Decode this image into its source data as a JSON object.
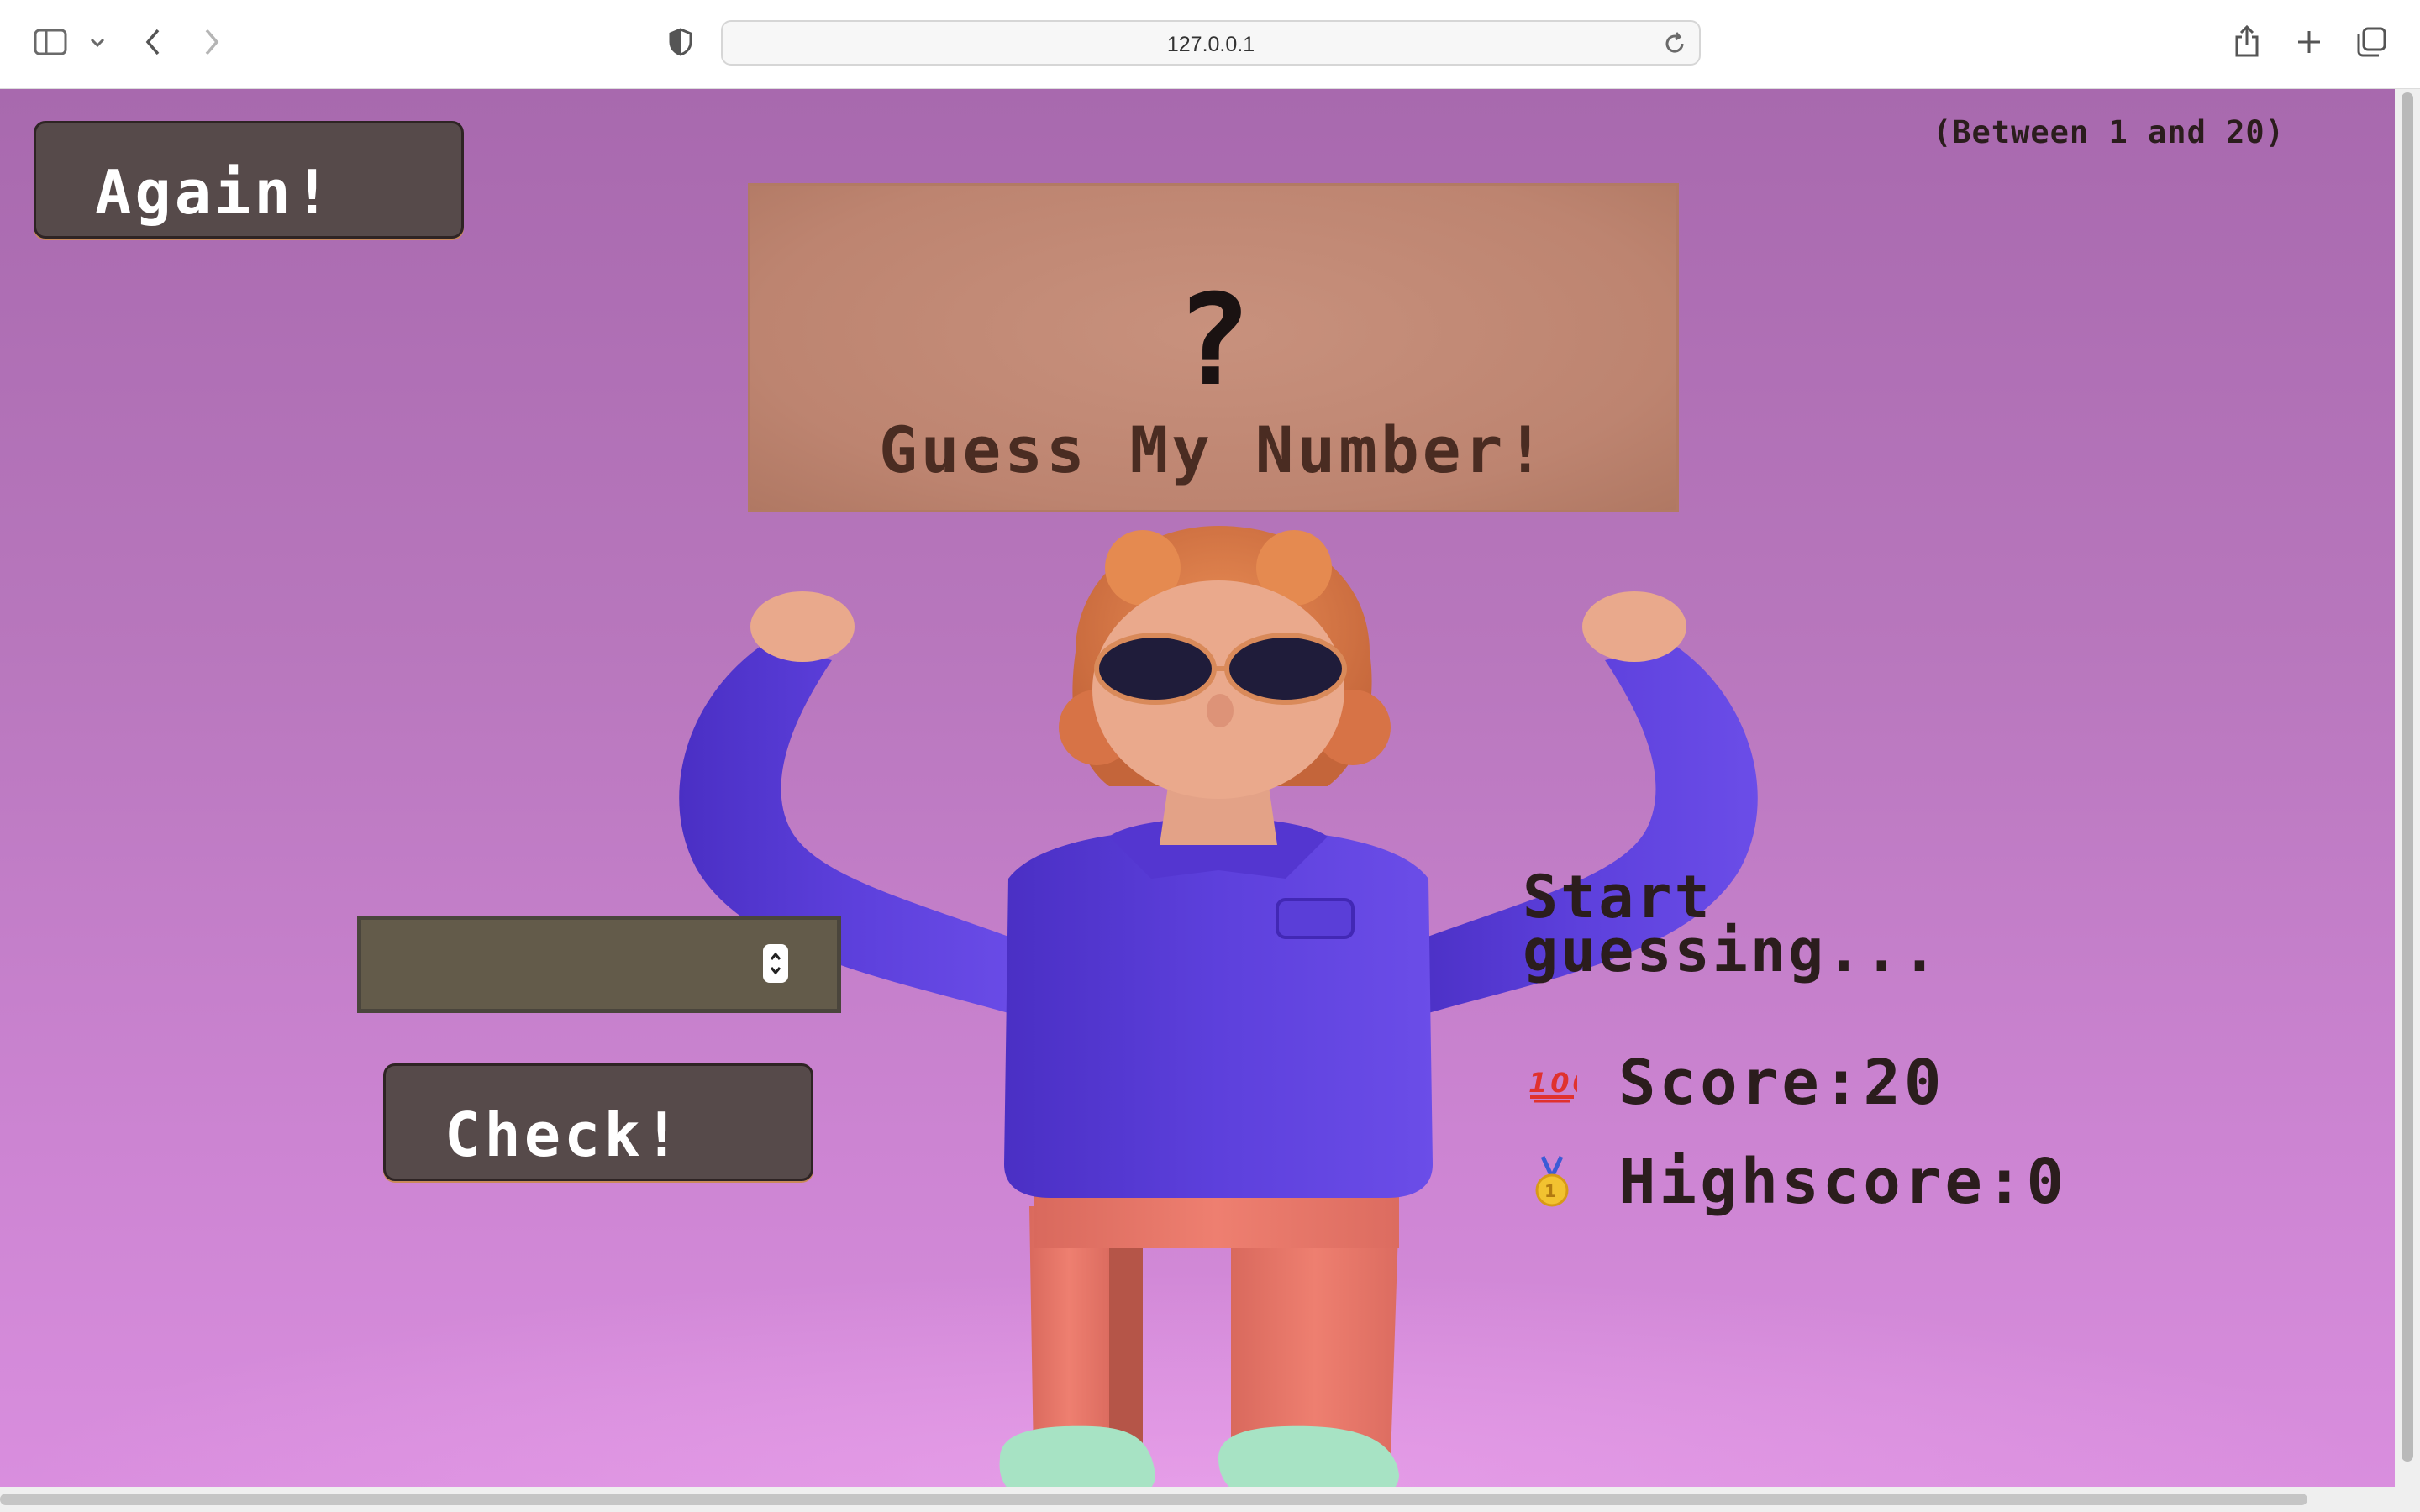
{
  "browser": {
    "url": "127.0.0.1",
    "icons": [
      "sidebar-icon",
      "chevron-down-icon",
      "back-icon",
      "forward-icon",
      "shield-icon",
      "reload-icon",
      "share-icon",
      "plus-icon",
      "tabs-icon"
    ]
  },
  "game": {
    "again_label": "Again!",
    "range_hint": "(Between 1 and 20)",
    "secret_placeholder": "?",
    "title": "Guess My Number!",
    "guess_value": "",
    "check_label": "Check!",
    "message_line1": "Start",
    "message_line2": "guessing...",
    "score_label": "Score: ",
    "score_value": "20",
    "highscore_label": "Highscore: ",
    "highscore_value": "0",
    "score_icon": "hundred-points-icon",
    "highscore_icon": "medal-icon"
  },
  "colors": {
    "background": "#b877bd",
    "button": "#564a4a",
    "sign": "#c08a76",
    "text": "#2b1d1d",
    "shirt": "#5b3ed6",
    "pants": "#e7776a"
  }
}
